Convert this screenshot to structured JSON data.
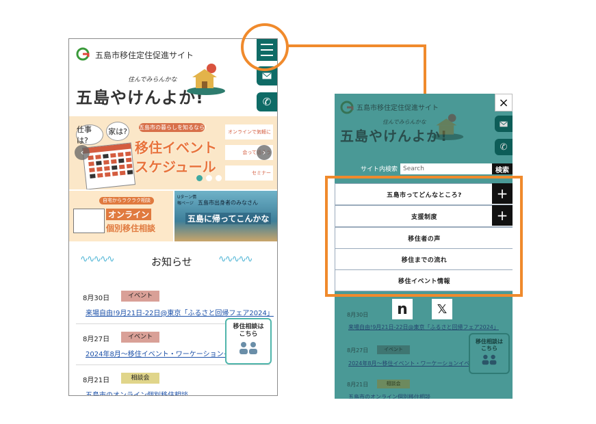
{
  "left_screen": {
    "site_title": "五島市移住定住促進サイト",
    "slogan_small": "住んでみらんかな",
    "slogan_big": "五島やけんよか!",
    "banner": {
      "bubble_1": "仕事は?",
      "bubble_2": "家は?",
      "pill": "五島市の暮らしを知るなら!",
      "title_line1": "移住イベント",
      "title_line2": "スケジュール",
      "side_1": "オンラインで気軽に",
      "side_2": "会って話そう",
      "side_3": "セミナー"
    },
    "sub_banner_1": {
      "pill": "自宅からラクラク相談",
      "line1": "オンライン",
      "line2": "個別移住相談"
    },
    "sub_banner_2": {
      "corner": "Uターン情報ページ",
      "line1": "五島市出身者のみなさん",
      "line2": "五島に帰ってこんかな"
    },
    "news_heading": "お知らせ",
    "news": [
      {
        "date": "8月30日",
        "tag": "イベント",
        "link": "来場自由!9月21日-22日@東京「ふるさと回帰フェア2024」"
      },
      {
        "date": "8月27日",
        "tag": "イベント",
        "link": "2024年8月～移住イベント・ワーケーションイベ"
      },
      {
        "date": "8月21日",
        "tag": "相談会",
        "link": "五島市のオンライン個別移住相談"
      }
    ],
    "consult_button": "移住相談は\nこちら"
  },
  "right_screen": {
    "site_title": "五島市移住定住促進サイト",
    "slogan_small": "住んでみらんかな",
    "slogan_big": "五島やけんよか!",
    "search_label": "サイト内検索",
    "search_placeholder": "Search",
    "search_button": "検索",
    "menu_items": [
      "五島市ってどんなところ?",
      "支援制度",
      "移住者の声",
      "移住までの流れ",
      "移住イベント情報"
    ],
    "plus_symbol": "+",
    "close_symbol": "×",
    "sns": [
      "n",
      "𝕏"
    ],
    "news": [
      {
        "date": "8月30日",
        "link": "来場自由!9月21日-22日@東京「ふるさと回帰フェア2024」"
      },
      {
        "date": "8月27日",
        "tag": "イベント",
        "link": "2024年8月～移住イベント・ワーケーションイベ"
      },
      {
        "date": "8月21日",
        "tag": "相談会",
        "link": "五島市のオンライン個別移住相談"
      }
    ],
    "consult_button": "移住相談は\nこちら"
  },
  "colors": {
    "highlight": "#f08a2c",
    "teal": "#0f6b66",
    "overlay": "#4a9996"
  }
}
